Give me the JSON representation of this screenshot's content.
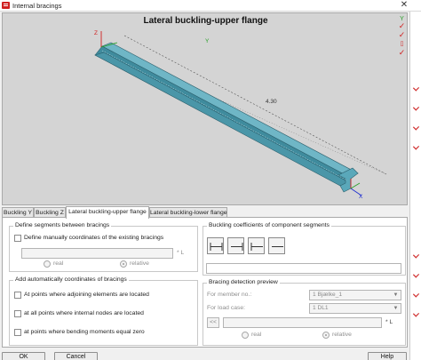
{
  "window": {
    "title": "Internal bracings",
    "close_glyph": "✕"
  },
  "viewport": {
    "title": "Lateral buckling-upper flange",
    "length_label": "4.30",
    "axes": {
      "z": "Z",
      "y": "Y",
      "x": "X"
    },
    "beam_color": "#4a96a8",
    "axis_color_z": "#d02020",
    "axis_color_y": "#2aa02a",
    "axis_color_x": "#2030d0"
  },
  "toolbar_icons": [
    "y-axis-icon",
    "check-red-icon",
    "check-red-icon",
    "grid-icon",
    "check-red-icon"
  ],
  "tabs": [
    {
      "label": "Buckling Y"
    },
    {
      "label": "Buckling Z"
    },
    {
      "label": "Lateral buckling-upper flange"
    },
    {
      "label": "Lateral buckling-lower flange"
    }
  ],
  "define_group": {
    "title": "Define segments between bracings",
    "manual_label": "Define manually coordinates of the existing bracings",
    "unit": "* L",
    "radio_real": "real",
    "radio_relative": "relative"
  },
  "auto_group": {
    "title": "Add automatically coordinates of bracings",
    "option1": "At points where adjoining elements are located",
    "option2": "at all points where internal nodes are located",
    "option3": "at points where bending moments equal zero"
  },
  "coeff_group": {
    "title": "Buckling coefficients of component segments"
  },
  "preview_group": {
    "title": "Bracing detection preview",
    "member_label": "For member no.:",
    "member_value": "1  Bjælke_1",
    "load_label": "For load case:",
    "load_value": "1  DL1",
    "prev_button": "<<",
    "unit": "* L",
    "radio_real": "real",
    "radio_relative": "relative"
  },
  "buttons": {
    "ok": "OK",
    "cancel": "Cancel",
    "help": "Help"
  }
}
